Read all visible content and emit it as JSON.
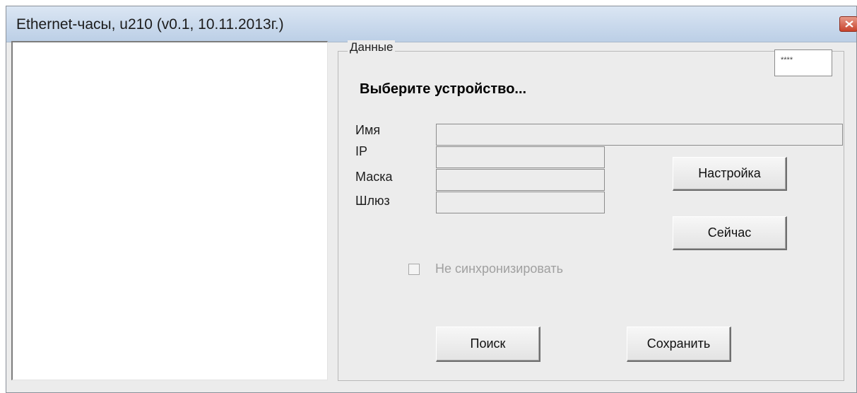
{
  "window": {
    "title": "Ethernet-часы, u210 (v0.1, 10.11.2013г.)",
    "close_icon": "close-icon"
  },
  "group": {
    "label": "Данные",
    "corner_field_value": "****",
    "heading": "Выберите устройство..."
  },
  "fields": {
    "name_label": "Имя",
    "ip_label": "IP",
    "mask_label": "Маска",
    "gateway_label": "Шлюз",
    "name_value": "",
    "ip_value": "",
    "mask_value": "",
    "gateway_value": ""
  },
  "buttons": {
    "settings": "Настройка",
    "now": "Сейчас",
    "search": "Поиск",
    "save": "Сохранить"
  },
  "options": {
    "no_sync_label": "Не синхронизировать",
    "no_sync_checked": false,
    "no_sync_enabled": false
  },
  "colors": {
    "title_bar": "#c9d9ec",
    "window_bg": "#ececec",
    "close_button": "#c8432d",
    "disabled_text": "#a0a0a0"
  }
}
